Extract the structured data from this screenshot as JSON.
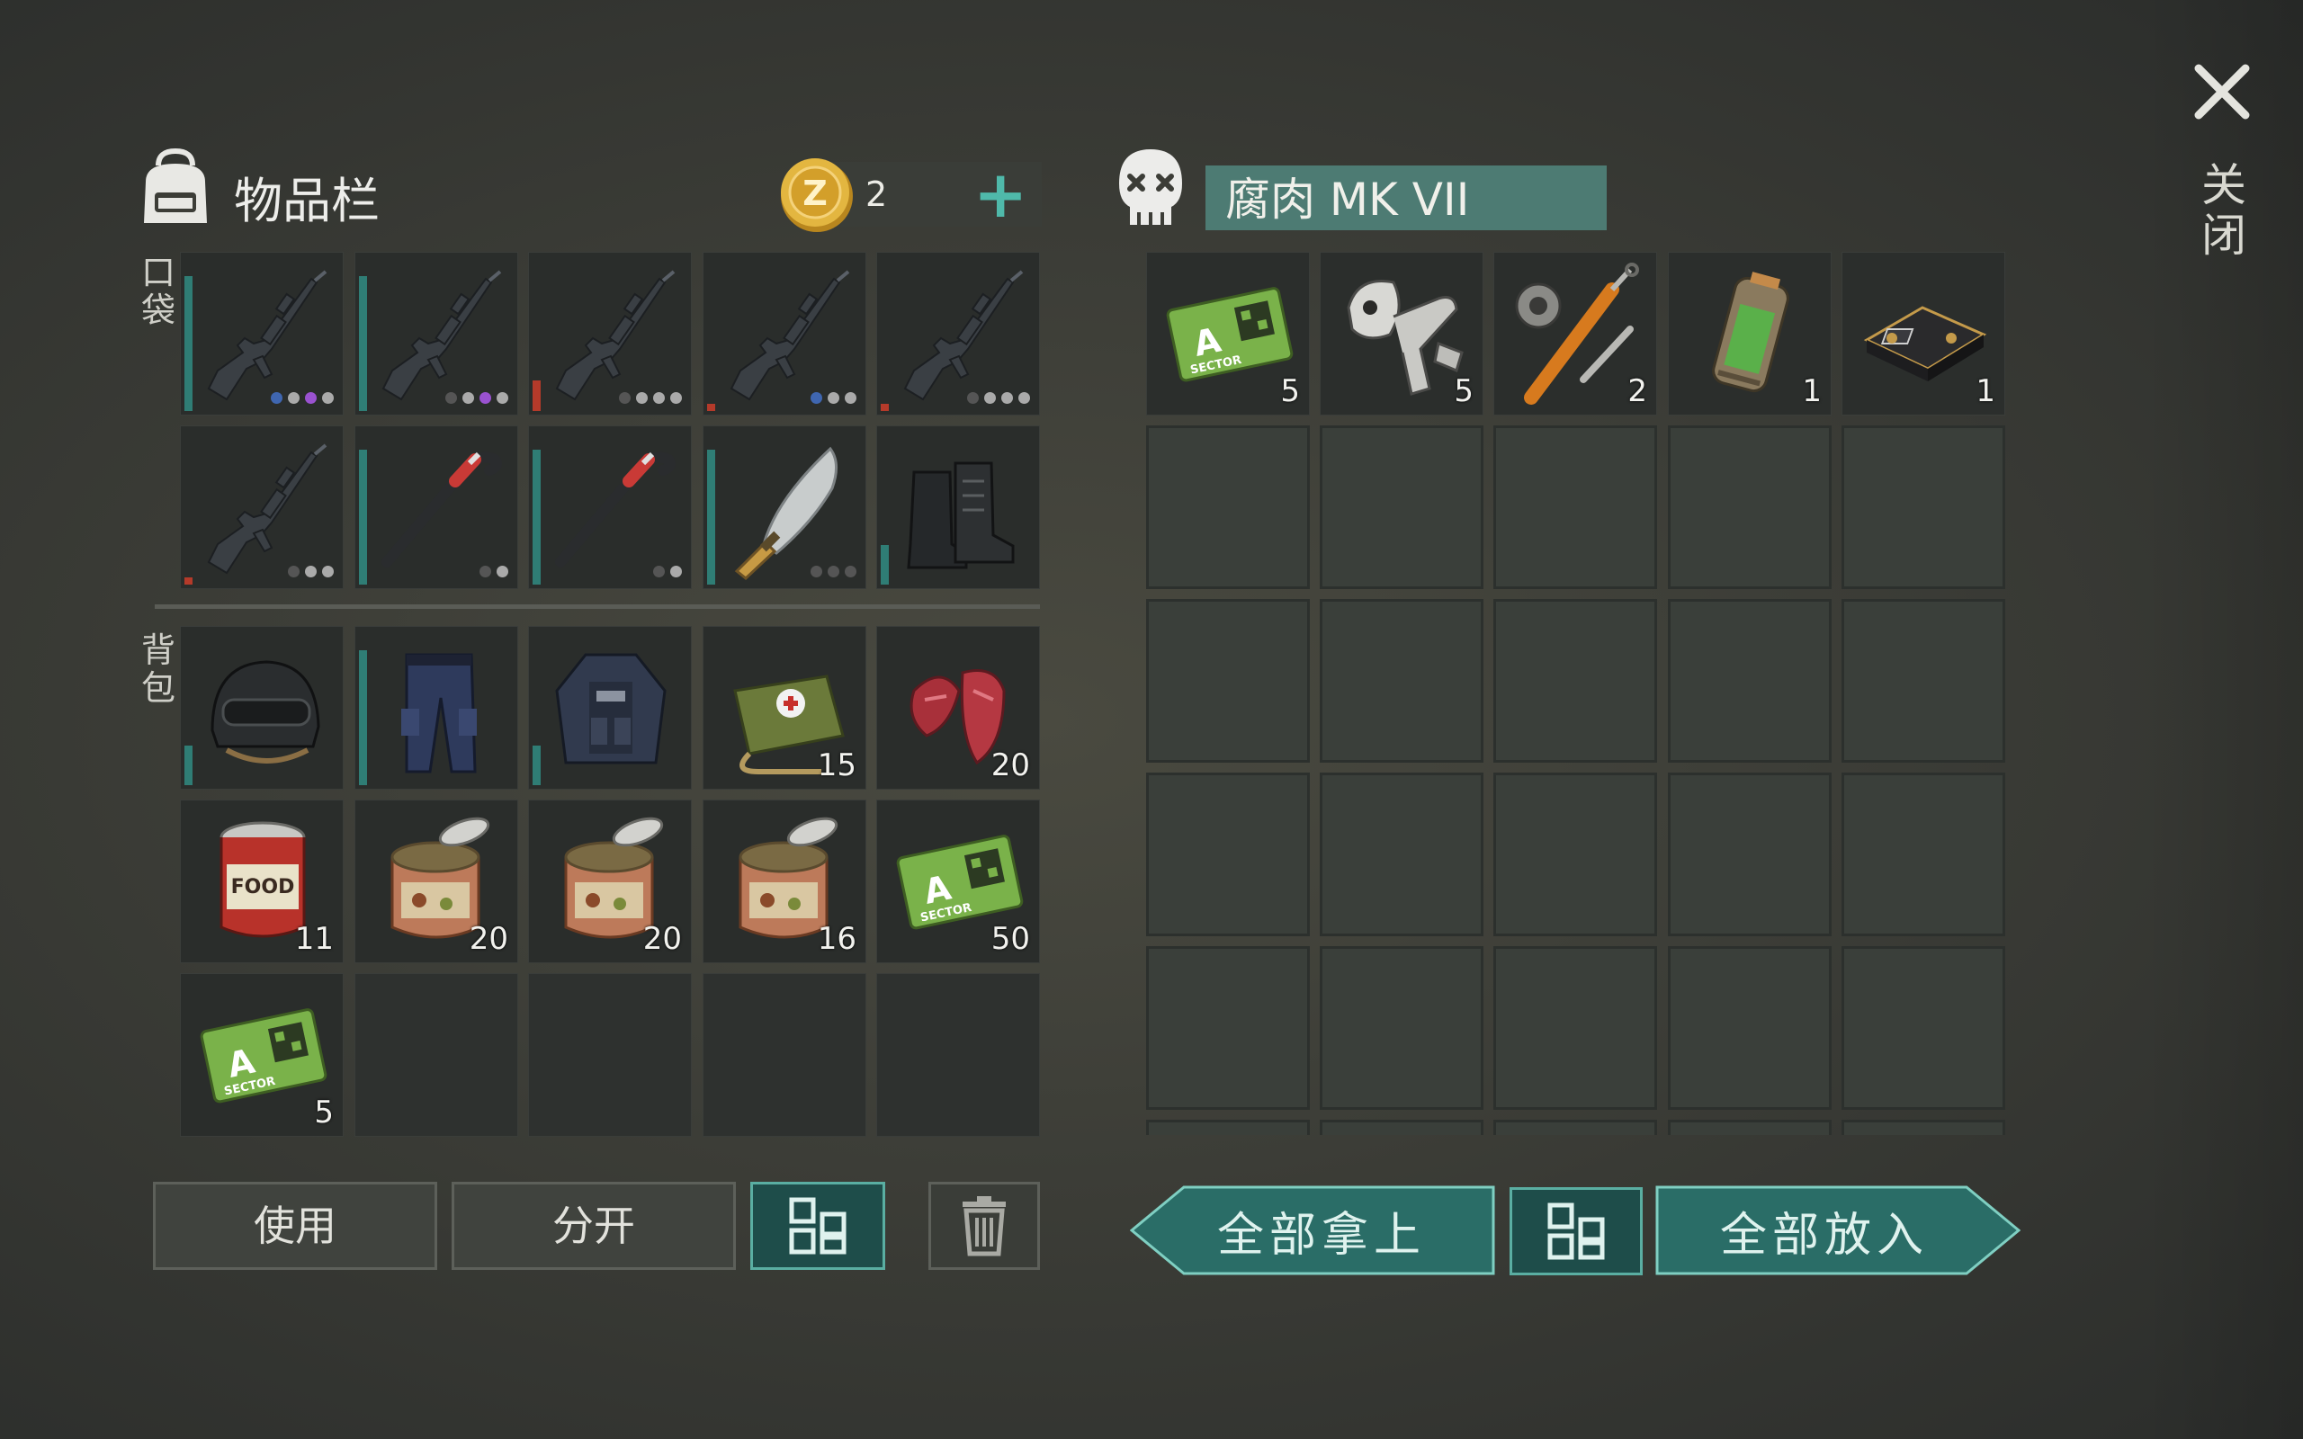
{
  "inventory": {
    "title": "物品栏",
    "coin_count": "2",
    "pockets_label": "口袋",
    "backpack_label": "背包",
    "pockets": [
      {
        "icon": "rifle-icon",
        "durability": "high",
        "dots": [
          "#3f66b0",
          "#aaaaaa",
          "#9a52d0",
          "#aaaaaa"
        ]
      },
      {
        "icon": "rifle-icon",
        "durability": "high",
        "dots": [
          "#555555",
          "#aaaaaa",
          "#9a52d0",
          "#aaaaaa"
        ]
      },
      {
        "icon": "rifle-icon",
        "durability": "low",
        "dots": [
          "#555555",
          "#aaaaaa",
          "#aaaaaa",
          "#aaaaaa"
        ]
      },
      {
        "icon": "rifle-icon",
        "durability": "verylow",
        "dots": [
          "#3f66b0",
          "#aaaaaa",
          "#aaaaaa"
        ]
      },
      {
        "icon": "rifle-icon",
        "durability": "verylow",
        "dots": [
          "#555555",
          "#aaaaaa",
          "#aaaaaa",
          "#aaaaaa"
        ]
      },
      {
        "icon": "rifle-icon",
        "durability": "verylow",
        "dots": [
          "#555555",
          "#aaaaaa",
          "#aaaaaa"
        ]
      },
      {
        "icon": "crowbar-icon",
        "durability": "high",
        "dots": [
          "#555555",
          "#aaaaaa"
        ]
      },
      {
        "icon": "crowbar-icon",
        "durability": "high",
        "dots": [
          "#555555",
          "#aaaaaa"
        ]
      },
      {
        "icon": "machete-icon",
        "durability": "high",
        "dots": [
          "#555555",
          "#555555",
          "#555555"
        ]
      },
      {
        "icon": "boots-icon",
        "durability": "mid",
        "dots": []
      }
    ],
    "backpack": [
      {
        "icon": "helmet-icon",
        "durability": "mid",
        "count": ""
      },
      {
        "icon": "pants-icon",
        "durability": "high",
        "count": ""
      },
      {
        "icon": "vest-icon",
        "durability": "mid",
        "count": ""
      },
      {
        "icon": "medkit-icon",
        "durability": "",
        "count": "15"
      },
      {
        "icon": "raw-meat-icon",
        "durability": "",
        "count": "20"
      },
      {
        "icon": "food-can-icon",
        "durability": "",
        "count": "11"
      },
      {
        "icon": "open-can-icon",
        "durability": "",
        "count": "20"
      },
      {
        "icon": "open-can-icon",
        "durability": "",
        "count": "20"
      },
      {
        "icon": "open-can-icon",
        "durability": "",
        "count": "16"
      },
      {
        "icon": "keycard-icon",
        "durability": "",
        "count": "50"
      },
      {
        "icon": "keycard-icon",
        "durability": "",
        "count": "5"
      },
      {
        "icon": "",
        "durability": "",
        "count": ""
      },
      {
        "icon": "",
        "durability": "",
        "count": ""
      },
      {
        "icon": "",
        "durability": "",
        "count": ""
      },
      {
        "icon": "",
        "durability": "",
        "count": ""
      }
    ],
    "buttons": {
      "use": "使用",
      "split": "分开"
    }
  },
  "loot": {
    "title": "腐肉 MK VII",
    "items": [
      {
        "icon": "keycard-icon",
        "count": "5"
      },
      {
        "icon": "bone-parts-icon",
        "count": "5"
      },
      {
        "icon": "hydraulic-cylinder-icon",
        "count": "2"
      },
      {
        "icon": "battery-canister-icon",
        "count": "1"
      },
      {
        "icon": "circuit-chip-icon",
        "count": "1"
      }
    ],
    "take_all": "全部拿上",
    "put_all": "全部放入"
  },
  "close_label": "关闭",
  "colors": {
    "teal": "#4fb9aa",
    "durability_high": "#2f7d75",
    "durability_low": "#b43a2a"
  }
}
